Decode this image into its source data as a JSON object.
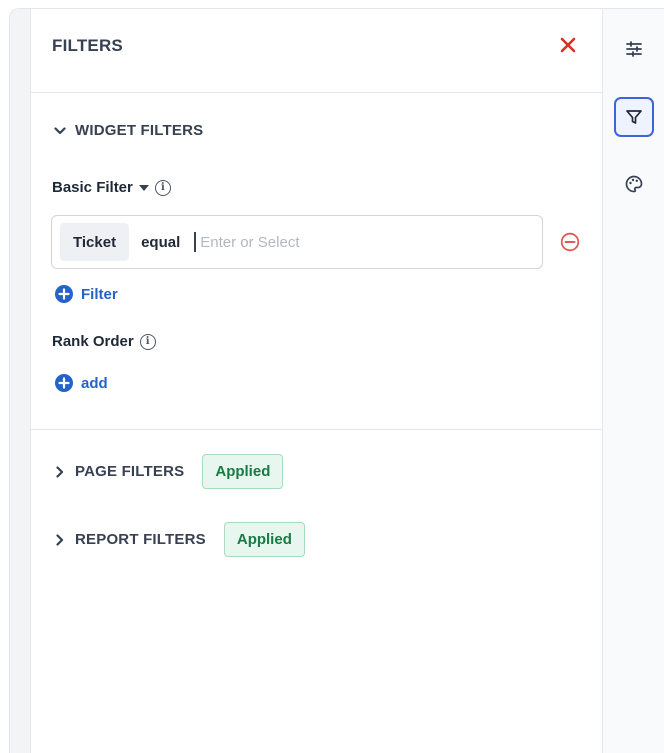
{
  "panel": {
    "title": "FILTERS",
    "close_icon": "close-icon",
    "accent_close": "#d93025"
  },
  "widget_filters": {
    "label": "WIDGET FILTERS",
    "expanded": true,
    "basic_filter": {
      "label": "Basic Filter",
      "rows": [
        {
          "field": "Ticket",
          "operator": "equal",
          "value": "",
          "placeholder": "Enter or Select"
        }
      ],
      "add_label": "Filter"
    },
    "rank_order": {
      "label": "Rank Order",
      "add_label": "add"
    }
  },
  "page_filters": {
    "label": "PAGE FILTERS",
    "expanded": false,
    "status": "Applied"
  },
  "report_filters": {
    "label": "REPORT FILTERS",
    "expanded": false,
    "status": "Applied"
  },
  "rail": {
    "items": [
      {
        "icon": "sliders-icon",
        "active": false
      },
      {
        "icon": "filter-icon",
        "active": true
      },
      {
        "icon": "palette-icon",
        "active": false
      }
    ]
  },
  "colors": {
    "link_blue": "#2563c9",
    "applied_bg": "#e7f6ee",
    "applied_text": "#197a44",
    "remove_red": "#e05a5a",
    "active_rail_border": "#3b66d6"
  }
}
